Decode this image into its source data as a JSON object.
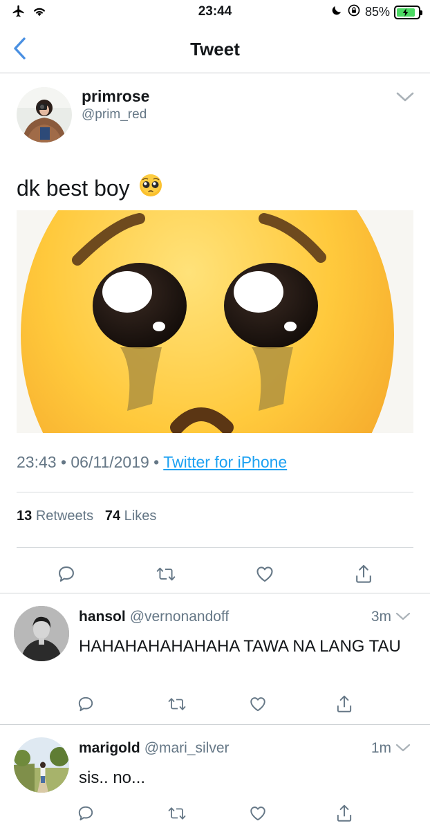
{
  "status_bar": {
    "time": "23:44",
    "battery_percent": "85%",
    "battery_level": 0.85
  },
  "nav": {
    "title": "Tweet",
    "back_icon": "chevron-left-icon"
  },
  "main_tweet": {
    "display_name": "primrose",
    "handle": "@prim_red",
    "text": "dk best boy",
    "timestamp": "23:43 • 06/11/2019 •",
    "source": "Twitter for iPhone",
    "retweets_count": "13",
    "retweets_label": "Retweets",
    "likes_count": "74",
    "likes_label": "Likes"
  },
  "replies": [
    {
      "display_name": "hansol",
      "handle": "@vernonandoff",
      "time": "3m",
      "text": "HAHAHAHAHAHAHA TAWA NA LANG TAU"
    },
    {
      "display_name": "marigold",
      "handle": "@mari_silver",
      "time": "1m",
      "text": "sis.. no..."
    }
  ],
  "colors": {
    "link": "#1da1f2",
    "secondary_text": "#657786",
    "icon_gray": "#657786",
    "back_blue": "#4a90e2"
  }
}
